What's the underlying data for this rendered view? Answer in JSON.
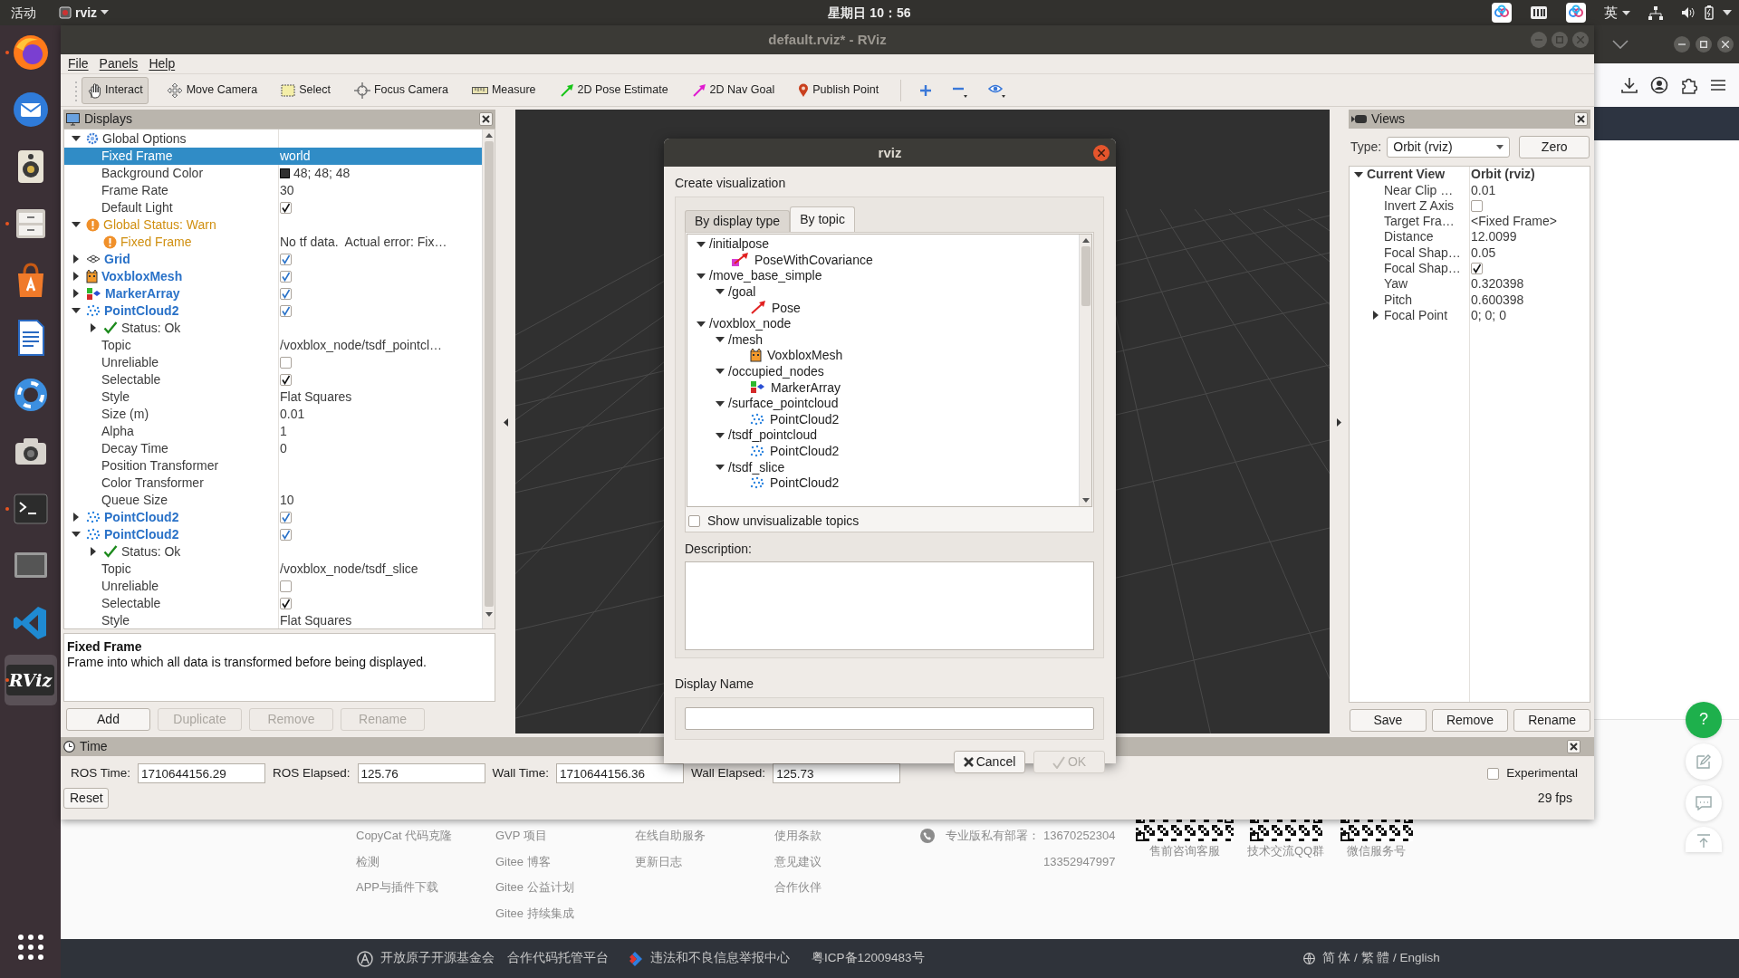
{
  "top_bar": {
    "activities": "活动",
    "app_menu": "rviz",
    "clock": "星期日 10：56",
    "input_method": "英"
  },
  "dock": [
    {
      "kind": "firefox",
      "running": true,
      "selected": false
    },
    {
      "kind": "thunderbird",
      "running": false,
      "selected": false
    },
    {
      "kind": "rhythmbox",
      "running": false,
      "selected": false
    },
    {
      "kind": "files",
      "running": true,
      "selected": false
    },
    {
      "kind": "software",
      "running": false,
      "selected": false
    },
    {
      "kind": "writer",
      "running": false,
      "selected": false
    },
    {
      "kind": "help",
      "running": false,
      "selected": false
    },
    {
      "kind": "screenshot",
      "running": false,
      "selected": false
    },
    {
      "kind": "terminal",
      "running": true,
      "selected": false
    },
    {
      "kind": "screen",
      "running": false,
      "selected": false
    },
    {
      "kind": "vscode",
      "running": false,
      "selected": false
    },
    {
      "kind": "rviz",
      "label": "RViz",
      "running": true,
      "selected": true
    },
    {
      "kind": "apps",
      "running": false,
      "selected": false
    }
  ],
  "window": {
    "title": "default.rviz* - RViz"
  },
  "menu": [
    "File",
    "Panels",
    "Help"
  ],
  "toolbar": [
    {
      "kind": "interact",
      "label": "Interact",
      "selected": true
    },
    {
      "kind": "move_camera",
      "label": "Move Camera",
      "selected": false
    },
    {
      "kind": "select",
      "label": "Select",
      "selected": false
    },
    {
      "kind": "focus_camera",
      "label": "Focus Camera",
      "selected": false
    },
    {
      "kind": "measure",
      "label": "Measure",
      "selected": false
    },
    {
      "kind": "pose_estimate",
      "label": "2D Pose Estimate",
      "selected": false
    },
    {
      "kind": "nav_goal",
      "label": "2D Nav Goal",
      "selected": false
    },
    {
      "kind": "publish_point",
      "label": "Publish Point",
      "selected": false
    }
  ],
  "toolbar_extras": [
    {
      "kind": "add"
    },
    {
      "kind": "remove"
    },
    {
      "kind": "view"
    }
  ],
  "displays": {
    "title": "Displays",
    "tree": [
      {
        "kind": "options",
        "label": "Global Options",
        "expanded": true,
        "selected": false,
        "children": [
          {
            "kind": "property",
            "label": "Fixed Frame",
            "value": "world",
            "selected": true
          },
          {
            "kind": "property",
            "label": "Background Color",
            "color": "#303030",
            "value": "48; 48; 48",
            "selected": false
          },
          {
            "kind": "property",
            "label": "Frame Rate",
            "value": "30",
            "selected": false
          },
          {
            "kind": "property",
            "label": "Default Light",
            "checked": true,
            "selected": false
          }
        ]
      },
      {
        "kind": "warn",
        "label": "Global Status: Warn",
        "expanded": true,
        "selected": false,
        "children": [
          {
            "kind": "warn",
            "label": "Fixed Frame",
            "value": "No tf data.  Actual error: Fix…",
            "selected": false
          }
        ]
      },
      {
        "kind": "grid",
        "label": "Grid",
        "expanded": false,
        "checked": true,
        "selected": false
      },
      {
        "kind": "mesh",
        "label": "VoxbloxMesh",
        "expanded": false,
        "checked": true,
        "selected": false
      },
      {
        "kind": "markers",
        "label": "MarkerArray",
        "expanded": false,
        "checked": true,
        "selected": false
      },
      {
        "kind": "points",
        "label": "PointCloud2",
        "expanded": true,
        "checked": true,
        "selected": false,
        "children": [
          {
            "kind": "ok",
            "label": "Status: Ok",
            "expanded": false,
            "selected": false
          },
          {
            "kind": "property",
            "label": "Topic",
            "value": "/voxblox_node/tsdf_pointcl…",
            "selected": false
          },
          {
            "kind": "property",
            "label": "Unreliable",
            "checked": false,
            "selected": false
          },
          {
            "kind": "property",
            "label": "Selectable",
            "checked": true,
            "selected": false
          },
          {
            "kind": "property",
            "label": "Style",
            "value": "Flat Squares",
            "selected": false
          },
          {
            "kind": "property",
            "label": "Size (m)",
            "value": "0.01",
            "selected": false
          },
          {
            "kind": "property",
            "label": "Alpha",
            "value": "1",
            "selected": false
          },
          {
            "kind": "property",
            "label": "Decay Time",
            "value": "0",
            "selected": false
          },
          {
            "kind": "property",
            "label": "Position Transformer",
            "selected": false
          },
          {
            "kind": "property",
            "label": "Color Transformer",
            "selected": false
          },
          {
            "kind": "property",
            "label": "Queue Size",
            "value": "10",
            "selected": false
          }
        ]
      },
      {
        "kind": "points",
        "label": "PointCloud2",
        "expanded": false,
        "checked": true,
        "selected": false
      },
      {
        "kind": "points",
        "label": "PointCloud2",
        "expanded": true,
        "checked": true,
        "selected": false,
        "children": [
          {
            "kind": "ok",
            "label": "Status: Ok",
            "expanded": false,
            "selected": false
          },
          {
            "kind": "property",
            "label": "Topic",
            "value": "/voxblox_node/tsdf_slice",
            "selected": false
          },
          {
            "kind": "property",
            "label": "Unreliable",
            "checked": false,
            "selected": false
          },
          {
            "kind": "property",
            "label": "Selectable",
            "checked": true,
            "selected": false
          },
          {
            "kind": "property",
            "label": "Style",
            "value": "Flat Squares",
            "selected": false
          }
        ]
      }
    ],
    "description": {
      "title": "Fixed Frame",
      "text": "Frame into which all data is transformed before being displayed."
    },
    "buttons": [
      {
        "label": "Add",
        "disabled": false
      },
      {
        "label": "Duplicate",
        "disabled": true
      },
      {
        "label": "Remove",
        "disabled": true
      },
      {
        "label": "Rename",
        "disabled": true
      }
    ]
  },
  "views": {
    "title": "Views",
    "type_label": "Type:",
    "type": "Orbit (rviz)",
    "zero": "Zero",
    "tree": [
      {
        "label": "Current View",
        "value": "Orbit (rviz)",
        "expanded": true,
        "children": [
          {
            "label": "Near Clip …",
            "value": "0.01"
          },
          {
            "label": "Invert Z Axis",
            "checked": false
          },
          {
            "label": "Target Fra…",
            "value": "<Fixed Frame>"
          },
          {
            "label": "Distance",
            "value": "12.0099"
          },
          {
            "label": "Focal Shap…",
            "value": "0.05"
          },
          {
            "label": "Focal Shap…",
            "checked": true
          },
          {
            "label": "Yaw",
            "value": "0.320398"
          },
          {
            "label": "Pitch",
            "value": "0.600398"
          },
          {
            "label": "Focal Point",
            "value": "0; 0; 0",
            "expanded": false
          }
        ]
      }
    ],
    "buttons": [
      "Save",
      "Remove",
      "Rename"
    ]
  },
  "time": {
    "title": "Time",
    "fields": [
      {
        "label": "ROS Time:",
        "value": "1710644156.29"
      },
      {
        "label": "ROS Elapsed:",
        "value": "125.76"
      },
      {
        "label": "Wall Time:",
        "value": "1710644156.36"
      },
      {
        "label": "Wall Elapsed:",
        "value": "125.73"
      }
    ],
    "experimental": {
      "label": "Experimental",
      "checked": false
    },
    "reset": "Reset",
    "fps": "29 fps"
  },
  "dialog": {
    "title": "rviz",
    "heading": "Create visualization",
    "tabs": [
      {
        "label": "By display type",
        "selected": false
      },
      {
        "label": "By topic",
        "selected": true
      }
    ],
    "topics": [
      {
        "label": "/initialpose",
        "expanded": true,
        "children": [
          {
            "kind": "pose_covariance",
            "label": "PoseWithCovariance"
          }
        ]
      },
      {
        "label": "/move_base_simple",
        "expanded": true,
        "children": [
          {
            "label": "/goal",
            "expanded": true,
            "children": [
              {
                "kind": "pose",
                "label": "Pose"
              }
            ]
          }
        ]
      },
      {
        "label": "/voxblox_node",
        "expanded": true,
        "children": [
          {
            "label": "/mesh",
            "expanded": true,
            "children": [
              {
                "kind": "mesh",
                "label": "VoxbloxMesh"
              }
            ]
          },
          {
            "label": "/occupied_nodes",
            "expanded": true,
            "children": [
              {
                "kind": "markers",
                "label": "MarkerArray"
              }
            ]
          },
          {
            "label": "/surface_pointcloud",
            "expanded": true,
            "children": [
              {
                "kind": "points",
                "label": "PointCloud2"
              }
            ]
          },
          {
            "label": "/tsdf_pointcloud",
            "expanded": true,
            "children": [
              {
                "kind": "points",
                "label": "PointCloud2"
              }
            ]
          },
          {
            "label": "/tsdf_slice",
            "expanded": true,
            "children": [
              {
                "kind": "points",
                "label": "PointCloud2"
              }
            ]
          }
        ]
      }
    ],
    "show_unvisualizable": {
      "label": "Show unvisualizable topics",
      "checked": false
    },
    "description_label": "Description:",
    "display_name_label": "Display Name",
    "buttons": [
      {
        "kind": "cancel",
        "label": "Cancel",
        "disabled": false
      },
      {
        "kind": "ok",
        "label": "OK",
        "disabled": true
      }
    ]
  },
  "browser": {
    "footer": {
      "columns": [
        [
          "CopyCat 代码克隆",
          "检测",
          "APP与插件下载"
        ],
        [
          "GVP 项目",
          "Gitee 博客",
          "Gitee 公益计划",
          "Gitee 持续集成"
        ],
        [
          "在线自助服务",
          "更新日志"
        ],
        [
          "使用条款",
          "意见建议",
          "合作伙伴"
        ]
      ],
      "contact": {
        "label": "专业版私有部署：",
        "phones": [
          "13670252304",
          "13352947997"
        ]
      },
      "qr_codes": [
        {
          "caption": "售前咨询客服"
        },
        {
          "caption": "技术交流QQ群"
        },
        {
          "caption": "微信服务号"
        }
      ],
      "bottom_bar": [
        {
          "kind": "atom",
          "text": "开放原子开源基金会"
        },
        {
          "kind": "plain",
          "text": "合作代码托管平台"
        },
        {
          "kind": "report",
          "text": "违法和不良信息举报中心"
        },
        {
          "kind": "plain",
          "text": "粤ICP备12009483号"
        }
      ],
      "languages": "简 体 / 繁 體 / English"
    },
    "float_buttons": [
      {
        "kind": "help",
        "text": "?"
      },
      {
        "kind": "edit"
      },
      {
        "kind": "chat"
      },
      {
        "kind": "top"
      }
    ]
  }
}
